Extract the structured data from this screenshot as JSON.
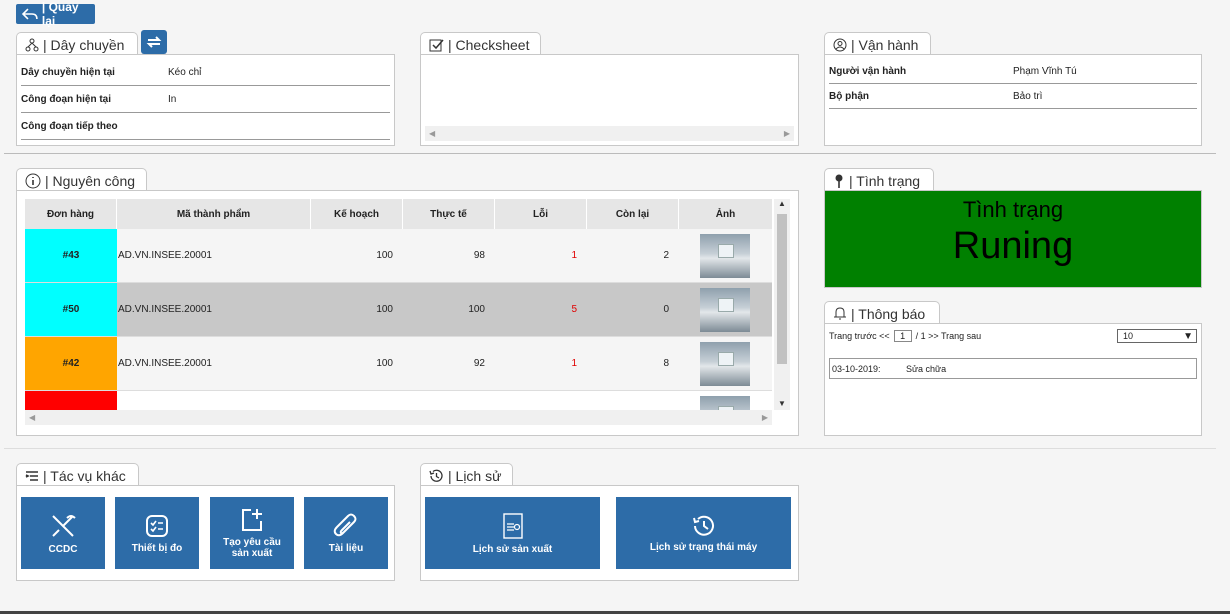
{
  "back_label": "| Quay lại",
  "line_panel": {
    "tab_label": "| Dây chuyền",
    "rows": [
      {
        "key": "Dây chuyền hiện tại",
        "value": "Kéo chỉ"
      },
      {
        "key": "Công đoạn hiện tại",
        "value": "In"
      },
      {
        "key": "Công đoạn tiếp theo",
        "value": ""
      }
    ]
  },
  "checksheet": {
    "tab_label": "| Checksheet"
  },
  "operator_panel": {
    "tab_label": "| Vận hành",
    "rows": [
      {
        "key": "Người vận hành",
        "value": "Phạm Vĩnh Tú"
      },
      {
        "key": "Bộ phận",
        "value": "Bảo trì"
      }
    ]
  },
  "work_panel": {
    "tab_label": "| Nguyên công",
    "columns": [
      "Đơn hàng",
      "Mã thành phẩm",
      "Kế hoạch",
      "Thực tế",
      "Lỗi",
      "Còn lại",
      "Ảnh"
    ],
    "rows": [
      {
        "order": "#43",
        "code": "AD.VN.INSEE.20001",
        "plan": "100",
        "actual": "98",
        "error": "1",
        "remain": "2",
        "color": "#00ffff",
        "bg": "#f5f5f5"
      },
      {
        "order": "#50",
        "code": "AD.VN.INSEE.20001",
        "plan": "100",
        "actual": "100",
        "error": "5",
        "remain": "0",
        "color": "#00ffff",
        "bg": "#c8c8c8"
      },
      {
        "order": "#42",
        "code": "AD.VN.INSEE.20001",
        "plan": "100",
        "actual": "92",
        "error": "1",
        "remain": "8",
        "color": "#ffa500",
        "bg": "#f5f5f5"
      },
      {
        "order": "",
        "code": "",
        "plan": "",
        "actual": "",
        "error": "",
        "remain": "",
        "color": "#ff0000",
        "bg": "#ffffff"
      }
    ]
  },
  "status_panel": {
    "tab_label": "| Tình trạng",
    "title": "Tình trạng",
    "value": "Runing",
    "color": "#008000"
  },
  "notify_panel": {
    "tab_label": "| Thông báo",
    "prev_label": "Trang trước <<",
    "page_value": "1",
    "page_info": "/ 1 >> Trang sau",
    "page_size": "10",
    "items": [
      {
        "date": "03-10-2019:",
        "text": "Sửa chữa"
      }
    ]
  },
  "other_tasks": {
    "tab_label": "| Tác vụ khác",
    "buttons": [
      "CCDC",
      "Thiết bị đo",
      "Tạo yêu cầu sản xuất",
      "Tài liệu"
    ]
  },
  "history": {
    "tab_label": "| Lịch sử",
    "buttons": [
      "Lịch sử sản xuất",
      "Lịch sử trạng thái máy"
    ]
  },
  "accent_color": "#2d6ca8"
}
